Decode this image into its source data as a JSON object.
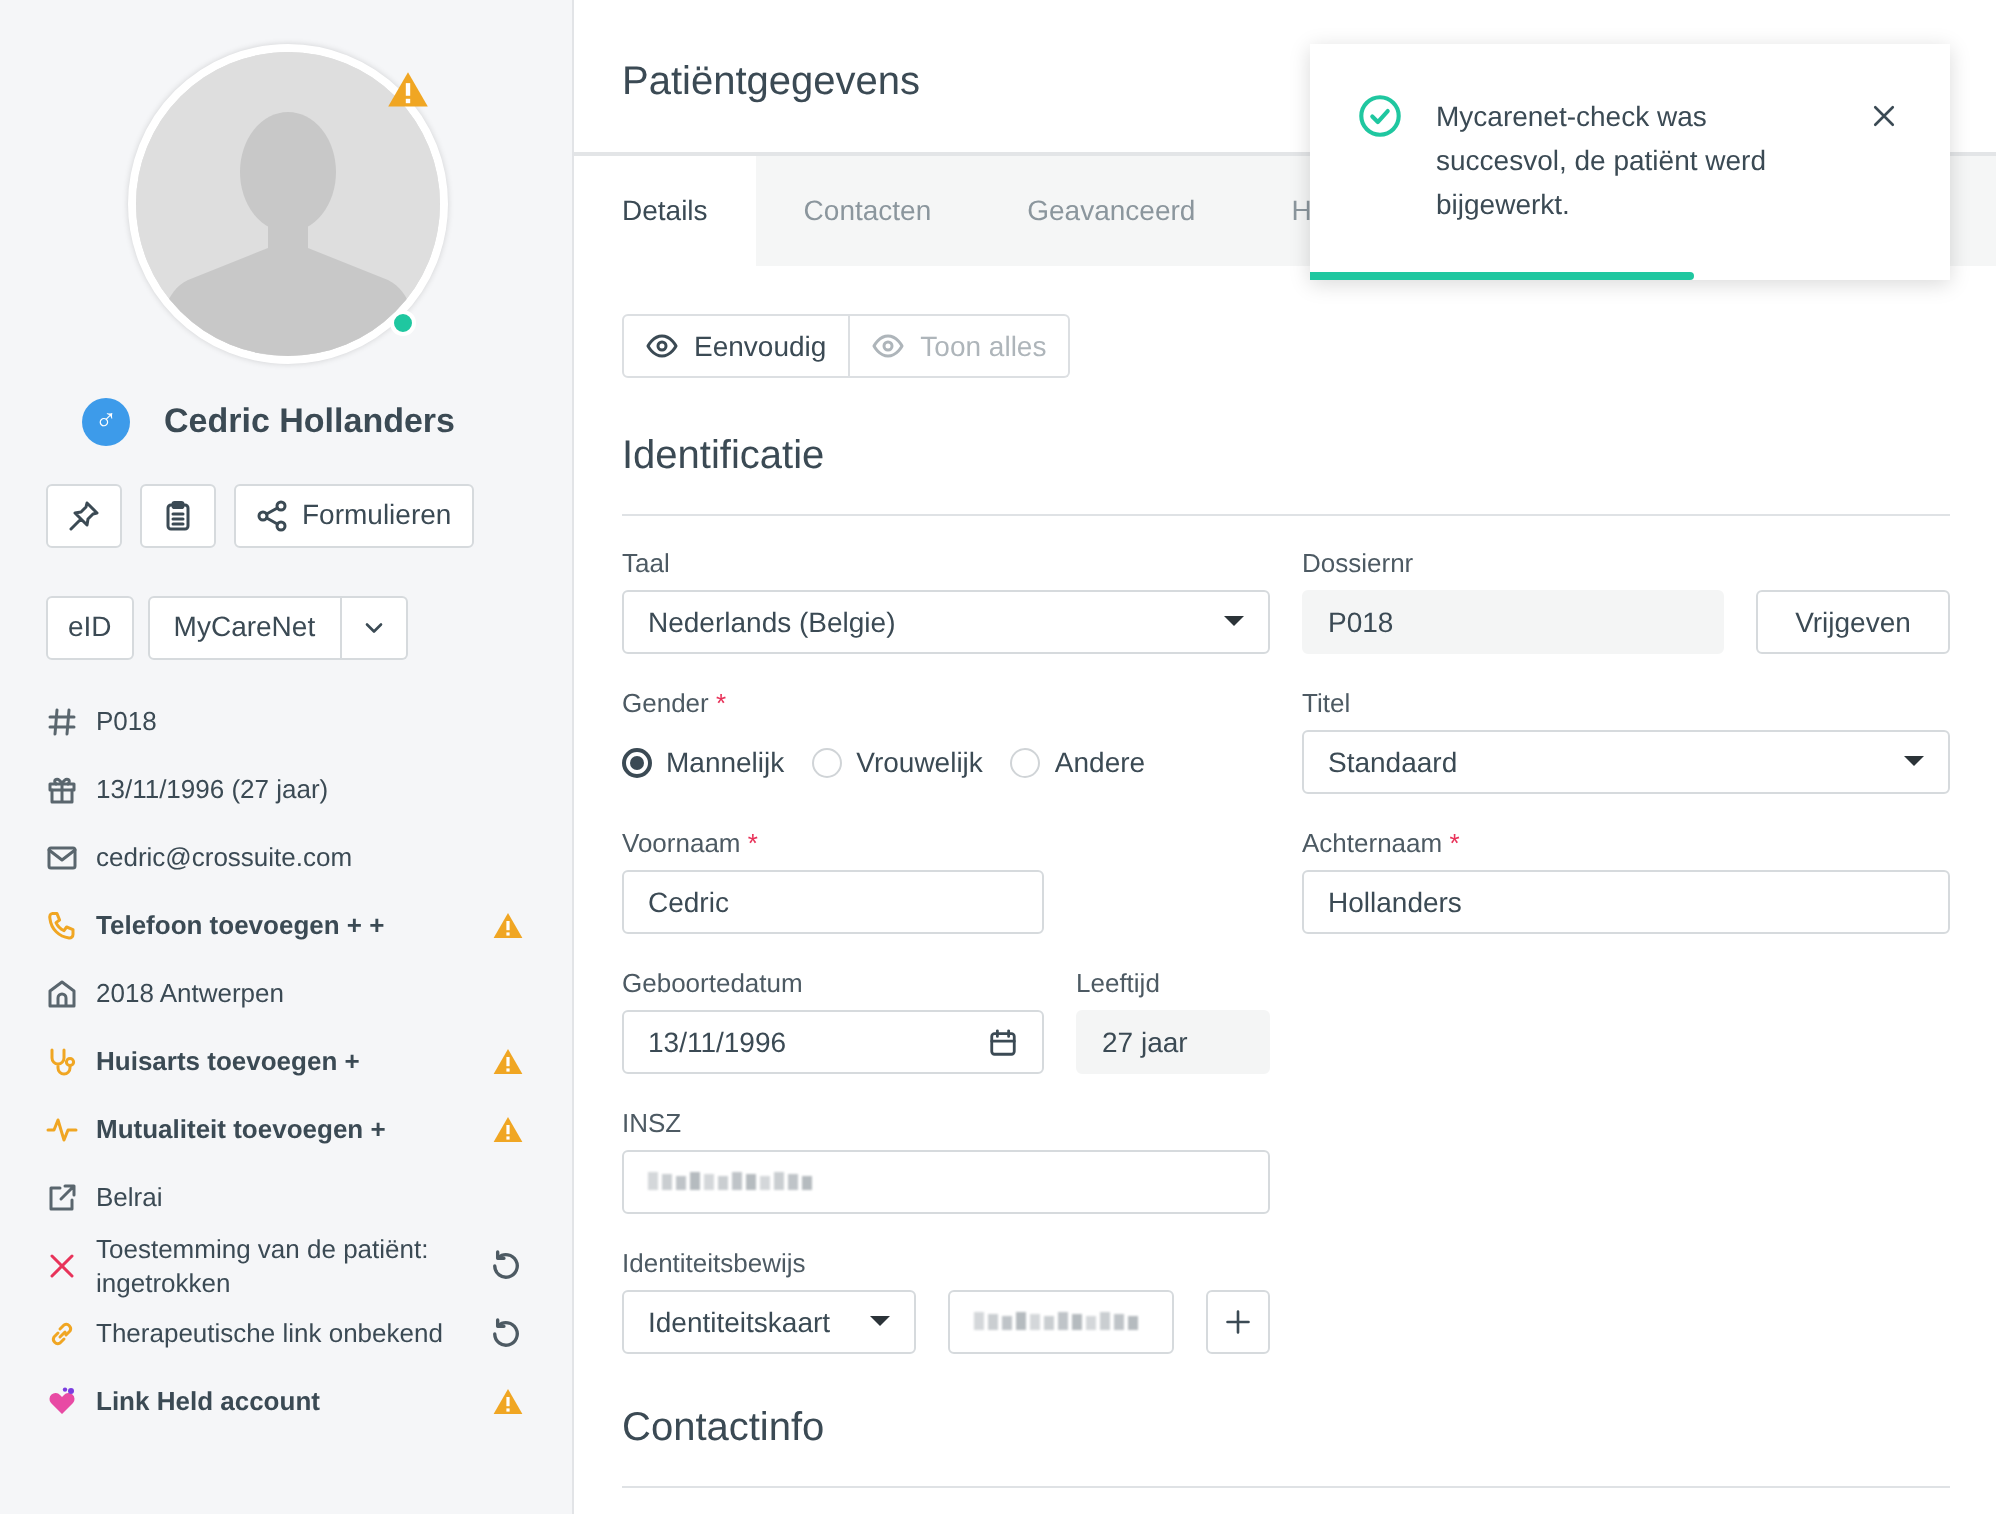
{
  "patient": {
    "name": "Cedric Hollanders",
    "gender_symbol": "♂",
    "photo_warning": true,
    "online": true
  },
  "sidebar_actions": [
    {
      "kind": "pin"
    },
    {
      "kind": "clipboard"
    },
    {
      "kind": "share",
      "label": "Formulieren"
    }
  ],
  "integrations": {
    "eid": "eID",
    "mycarenet": "MyCareNet"
  },
  "info_items": [
    {
      "kind": "hash",
      "text": "P018",
      "bold": false,
      "warning": false,
      "refreshable": false
    },
    {
      "kind": "gift",
      "text": "13/11/1996 (27 jaar)",
      "bold": false,
      "warning": false,
      "refreshable": false
    },
    {
      "kind": "mail",
      "text": "cedric@crossuite.com",
      "bold": false,
      "warning": false,
      "refreshable": false
    },
    {
      "kind": "phone",
      "text": "Telefoon toevoegen + +",
      "bold": true,
      "warning": true,
      "refreshable": false
    },
    {
      "kind": "home",
      "text": "2018 Antwerpen",
      "bold": false,
      "warning": false,
      "refreshable": false
    },
    {
      "kind": "stethoscope",
      "text": "Huisarts toevoegen +",
      "bold": true,
      "warning": true,
      "refreshable": false
    },
    {
      "kind": "pulse",
      "text": "Mutualiteit toevoegen +",
      "bold": true,
      "warning": true,
      "refreshable": false
    },
    {
      "kind": "external",
      "text": "Belrai",
      "bold": false,
      "warning": false,
      "refreshable": false
    },
    {
      "kind": "cross",
      "text": "Toestemming van de patiënt: ingetrokken",
      "bold": false,
      "warning": false,
      "refreshable": true
    },
    {
      "kind": "link",
      "text": "Therapeutische link onbekend",
      "bold": false,
      "warning": false,
      "refreshable": true
    },
    {
      "kind": "heart",
      "text": "Link Held account",
      "bold": true,
      "warning": true,
      "refreshable": false
    }
  ],
  "page_title": "Patiëntgegevens",
  "tabs": [
    {
      "label": "Details",
      "selected": true
    },
    {
      "label": "Contacten",
      "selected": false
    },
    {
      "label": "Geavanceerd",
      "selected": false
    },
    {
      "label": "H",
      "selected": false
    }
  ],
  "view_toggle": [
    {
      "label": "Eenvoudig",
      "selected": true
    },
    {
      "label": "Toon alles",
      "selected": false
    }
  ],
  "identification": {
    "heading": "Identificatie",
    "taal": {
      "label": "Taal",
      "value": "Nederlands (Belgie)"
    },
    "dossiernr": {
      "label": "Dossiernr",
      "value": "P018",
      "button": "Vrijgeven"
    },
    "gender": {
      "label": "Gender",
      "required_mark": "*",
      "options": [
        {
          "label": "Mannelijk",
          "selected": true
        },
        {
          "label": "Vrouwelijk",
          "selected": false
        },
        {
          "label": "Andere",
          "selected": false
        }
      ]
    },
    "titel": {
      "label": "Titel",
      "value": "Standaard"
    },
    "voornaam": {
      "label": "Voornaam",
      "required_mark": "*",
      "value": "Cedric"
    },
    "achternaam": {
      "label": "Achternaam",
      "required_mark": "*",
      "value": "Hollanders"
    },
    "geboortedatum": {
      "label": "Geboortedatum",
      "value": "13/11/1996"
    },
    "leeftijd": {
      "label": "Leeftijd",
      "value": "27 jaar"
    },
    "insz": {
      "label": "INSZ",
      "blurred": true
    },
    "identiteitsbewijs": {
      "label": "Identiteitsbewijs",
      "value": "Identiteitskaart",
      "number_blurred": true
    }
  },
  "contact_heading": "Contactinfo",
  "toast": {
    "message": "Mycarenet-check was succesvol, de patiënt werd bijgewerkt.",
    "level": 0.6
  }
}
